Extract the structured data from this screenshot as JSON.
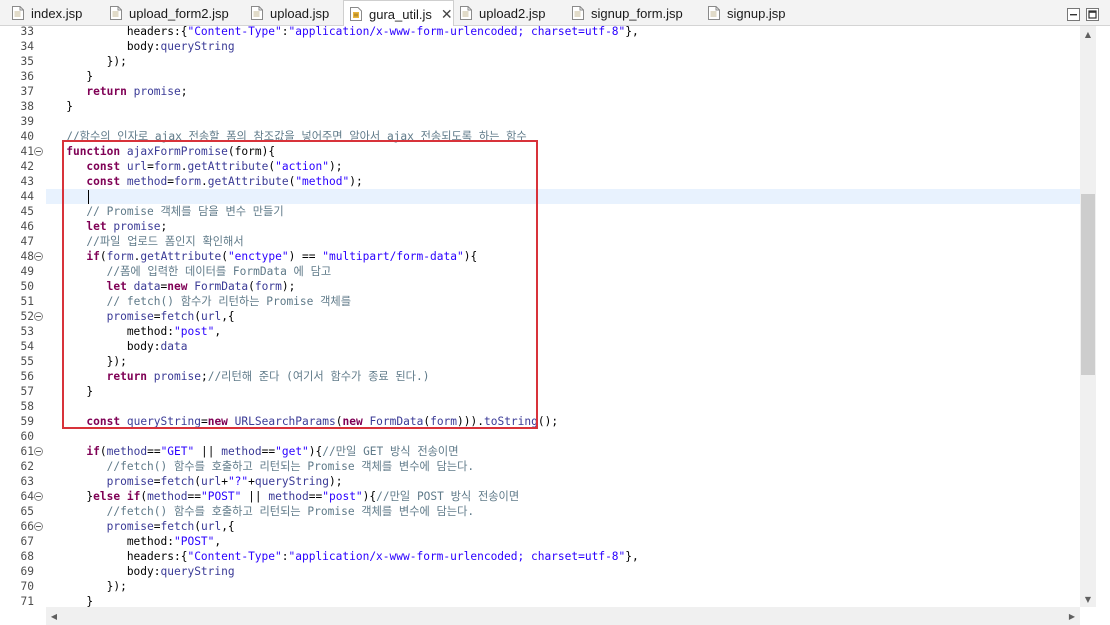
{
  "tabs": [
    {
      "label": "index.jsp",
      "active": false
    },
    {
      "label": "upload_form2.jsp",
      "active": false
    },
    {
      "label": "upload.jsp",
      "active": false
    },
    {
      "label": "gura_util.js",
      "active": true
    },
    {
      "label": "upload2.jsp",
      "active": false
    },
    {
      "label": "signup_form.jsp",
      "active": false
    },
    {
      "label": "signup.jsp",
      "active": false
    }
  ],
  "close_glyph": "✕",
  "editor": {
    "current_line": 44,
    "lines": [
      {
        "n": 33,
        "fold": false,
        "segs": [
          [
            "pl",
            "            headers:{"
          ],
          [
            "str",
            "\"Content-Type\""
          ],
          [
            "pl",
            ":"
          ],
          [
            "str",
            "\"application/x-www-form-urlencoded; charset=utf-8\""
          ],
          [
            "pl",
            "},"
          ]
        ]
      },
      {
        "n": 34,
        "fold": false,
        "segs": [
          [
            "pl",
            "            body:"
          ],
          [
            "id",
            "queryString"
          ]
        ]
      },
      {
        "n": 35,
        "fold": false,
        "segs": [
          [
            "pl",
            "         });"
          ]
        ]
      },
      {
        "n": 36,
        "fold": false,
        "segs": [
          [
            "pl",
            "      }"
          ]
        ]
      },
      {
        "n": 37,
        "fold": false,
        "segs": [
          [
            "pl",
            "      "
          ],
          [
            "kw",
            "return"
          ],
          [
            "pl",
            " "
          ],
          [
            "id",
            "promise"
          ],
          [
            "pl",
            ";"
          ]
        ]
      },
      {
        "n": 38,
        "fold": false,
        "segs": [
          [
            "pl",
            "   }"
          ]
        ]
      },
      {
        "n": 39,
        "fold": false,
        "segs": []
      },
      {
        "n": 40,
        "fold": false,
        "segs": [
          [
            "cm",
            "   //함수의 인자로 ajax 전송할 폼의 참조값을 넣어주면 알아서 ajax 전송되도록 하는 함수"
          ]
        ]
      },
      {
        "n": 41,
        "fold": true,
        "segs": [
          [
            "pl",
            "   "
          ],
          [
            "kw",
            "function"
          ],
          [
            "pl",
            " "
          ],
          [
            "id",
            "ajaxFormPromise"
          ],
          [
            "pl",
            "(form){"
          ]
        ]
      },
      {
        "n": 42,
        "fold": false,
        "segs": [
          [
            "pl",
            "      "
          ],
          [
            "kw",
            "const"
          ],
          [
            "pl",
            " "
          ],
          [
            "id",
            "url"
          ],
          [
            "pl",
            "="
          ],
          [
            "id",
            "form"
          ],
          [
            "pl",
            "."
          ],
          [
            "id",
            "getAttribute"
          ],
          [
            "pl",
            "("
          ],
          [
            "str",
            "\"action\""
          ],
          [
            "pl",
            ");"
          ]
        ]
      },
      {
        "n": 43,
        "fold": false,
        "segs": [
          [
            "pl",
            "      "
          ],
          [
            "kw",
            "const"
          ],
          [
            "pl",
            " "
          ],
          [
            "id",
            "method"
          ],
          [
            "pl",
            "="
          ],
          [
            "id",
            "form"
          ],
          [
            "pl",
            "."
          ],
          [
            "id",
            "getAttribute"
          ],
          [
            "pl",
            "("
          ],
          [
            "str",
            "\"method\""
          ],
          [
            "pl",
            ");"
          ]
        ]
      },
      {
        "n": 44,
        "fold": false,
        "segs": [
          [
            "pl",
            "      "
          ]
        ]
      },
      {
        "n": 45,
        "fold": false,
        "segs": [
          [
            "pl",
            "      "
          ],
          [
            "cm",
            "// Promise 객체를 담을 변수 만들기"
          ]
        ]
      },
      {
        "n": 46,
        "fold": false,
        "segs": [
          [
            "pl",
            "      "
          ],
          [
            "kw",
            "let"
          ],
          [
            "pl",
            " "
          ],
          [
            "id",
            "promise"
          ],
          [
            "pl",
            ";"
          ]
        ]
      },
      {
        "n": 47,
        "fold": false,
        "segs": [
          [
            "pl",
            "      "
          ],
          [
            "cm",
            "//파일 업로드 폼인지 확인해서"
          ]
        ]
      },
      {
        "n": 48,
        "fold": true,
        "segs": [
          [
            "pl",
            "      "
          ],
          [
            "kw",
            "if"
          ],
          [
            "pl",
            "("
          ],
          [
            "id",
            "form"
          ],
          [
            "pl",
            "."
          ],
          [
            "id",
            "getAttribute"
          ],
          [
            "pl",
            "("
          ],
          [
            "str",
            "\"enctype\""
          ],
          [
            "pl",
            ") == "
          ],
          [
            "str",
            "\"multipart/form-data\""
          ],
          [
            "pl",
            "){"
          ]
        ]
      },
      {
        "n": 49,
        "fold": false,
        "segs": [
          [
            "pl",
            "         "
          ],
          [
            "cm",
            "//폼에 입력한 데이터를 FormData 에 담고"
          ]
        ]
      },
      {
        "n": 50,
        "fold": false,
        "segs": [
          [
            "pl",
            "         "
          ],
          [
            "kw",
            "let"
          ],
          [
            "pl",
            " "
          ],
          [
            "id",
            "data"
          ],
          [
            "pl",
            "="
          ],
          [
            "kw",
            "new"
          ],
          [
            "pl",
            " "
          ],
          [
            "id",
            "FormData"
          ],
          [
            "pl",
            "("
          ],
          [
            "id",
            "form"
          ],
          [
            "pl",
            ");"
          ]
        ]
      },
      {
        "n": 51,
        "fold": false,
        "segs": [
          [
            "pl",
            "         "
          ],
          [
            "cm",
            "// fetch() 함수가 리턴하는 Promise 객체를"
          ]
        ]
      },
      {
        "n": 52,
        "fold": true,
        "segs": [
          [
            "pl",
            "         "
          ],
          [
            "id",
            "promise"
          ],
          [
            "pl",
            "="
          ],
          [
            "id",
            "fetch"
          ],
          [
            "pl",
            "("
          ],
          [
            "id",
            "url"
          ],
          [
            "pl",
            ",{"
          ]
        ]
      },
      {
        "n": 53,
        "fold": false,
        "segs": [
          [
            "pl",
            "            method:"
          ],
          [
            "str",
            "\"post\""
          ],
          [
            "pl",
            ","
          ]
        ]
      },
      {
        "n": 54,
        "fold": false,
        "segs": [
          [
            "pl",
            "            body:"
          ],
          [
            "id",
            "data"
          ]
        ]
      },
      {
        "n": 55,
        "fold": false,
        "segs": [
          [
            "pl",
            "         });"
          ]
        ]
      },
      {
        "n": 56,
        "fold": false,
        "segs": [
          [
            "pl",
            "         "
          ],
          [
            "kw",
            "return"
          ],
          [
            "pl",
            " "
          ],
          [
            "id",
            "promise"
          ],
          [
            "pl",
            ";"
          ],
          [
            "cm",
            "//리턴해 준다 (여기서 함수가 종료 된다.)"
          ]
        ]
      },
      {
        "n": 57,
        "fold": false,
        "segs": [
          [
            "pl",
            "      }"
          ]
        ]
      },
      {
        "n": 58,
        "fold": false,
        "segs": []
      },
      {
        "n": 59,
        "fold": false,
        "segs": [
          [
            "pl",
            "      "
          ],
          [
            "kw",
            "const"
          ],
          [
            "pl",
            " "
          ],
          [
            "id",
            "queryString"
          ],
          [
            "pl",
            "="
          ],
          [
            "kw",
            "new"
          ],
          [
            "pl",
            " "
          ],
          [
            "id",
            "URLSearchParams"
          ],
          [
            "pl",
            "("
          ],
          [
            "kw",
            "new"
          ],
          [
            "pl",
            " "
          ],
          [
            "id",
            "FormData"
          ],
          [
            "pl",
            "("
          ],
          [
            "id",
            "form"
          ],
          [
            "pl",
            ")))."
          ],
          [
            "id",
            "toString"
          ],
          [
            "pl",
            "();"
          ]
        ]
      },
      {
        "n": 60,
        "fold": false,
        "segs": []
      },
      {
        "n": 61,
        "fold": true,
        "segs": [
          [
            "pl",
            "      "
          ],
          [
            "kw",
            "if"
          ],
          [
            "pl",
            "("
          ],
          [
            "id",
            "method"
          ],
          [
            "pl",
            "=="
          ],
          [
            "str",
            "\"GET\""
          ],
          [
            "pl",
            " || "
          ],
          [
            "id",
            "method"
          ],
          [
            "pl",
            "=="
          ],
          [
            "str",
            "\"get\""
          ],
          [
            "pl",
            "){"
          ],
          [
            "cm",
            "//만일 GET 방식 전송이면"
          ]
        ]
      },
      {
        "n": 62,
        "fold": false,
        "segs": [
          [
            "pl",
            "         "
          ],
          [
            "cm",
            "//fetch() 함수를 호출하고 리턴되는 Promise 객체를 변수에 담는다."
          ]
        ]
      },
      {
        "n": 63,
        "fold": false,
        "segs": [
          [
            "pl",
            "         "
          ],
          [
            "id",
            "promise"
          ],
          [
            "pl",
            "="
          ],
          [
            "id",
            "fetch"
          ],
          [
            "pl",
            "("
          ],
          [
            "id",
            "url"
          ],
          [
            "pl",
            "+"
          ],
          [
            "str",
            "\"?\""
          ],
          [
            "pl",
            "+"
          ],
          [
            "id",
            "queryString"
          ],
          [
            "pl",
            ");"
          ]
        ]
      },
      {
        "n": 64,
        "fold": true,
        "segs": [
          [
            "pl",
            "      }"
          ],
          [
            "kw",
            "else if"
          ],
          [
            "pl",
            "("
          ],
          [
            "id",
            "method"
          ],
          [
            "pl",
            "=="
          ],
          [
            "str",
            "\"POST\""
          ],
          [
            "pl",
            " || "
          ],
          [
            "id",
            "method"
          ],
          [
            "pl",
            "=="
          ],
          [
            "str",
            "\"post\""
          ],
          [
            "pl",
            "){"
          ],
          [
            "cm",
            "//만일 POST 방식 전송이면"
          ]
        ]
      },
      {
        "n": 65,
        "fold": false,
        "segs": [
          [
            "pl",
            "         "
          ],
          [
            "cm",
            "//fetch() 함수를 호출하고 리턴되는 Promise 객체를 변수에 담는다."
          ]
        ]
      },
      {
        "n": 66,
        "fold": true,
        "segs": [
          [
            "pl",
            "         "
          ],
          [
            "id",
            "promise"
          ],
          [
            "pl",
            "="
          ],
          [
            "id",
            "fetch"
          ],
          [
            "pl",
            "("
          ],
          [
            "id",
            "url"
          ],
          [
            "pl",
            ",{"
          ]
        ]
      },
      {
        "n": 67,
        "fold": false,
        "segs": [
          [
            "pl",
            "            method:"
          ],
          [
            "str",
            "\"POST\""
          ],
          [
            "pl",
            ","
          ]
        ]
      },
      {
        "n": 68,
        "fold": false,
        "segs": [
          [
            "pl",
            "            headers:{"
          ],
          [
            "str",
            "\"Content-Type\""
          ],
          [
            "pl",
            ":"
          ],
          [
            "str",
            "\"application/x-www-form-urlencoded; charset=utf-8\""
          ],
          [
            "pl",
            "},"
          ]
        ]
      },
      {
        "n": 69,
        "fold": false,
        "segs": [
          [
            "pl",
            "            body:"
          ],
          [
            "id",
            "queryString"
          ]
        ]
      },
      {
        "n": 70,
        "fold": false,
        "segs": [
          [
            "pl",
            "         });"
          ]
        ]
      },
      {
        "n": 71,
        "fold": false,
        "segs": [
          [
            "pl",
            "      }"
          ]
        ]
      }
    ]
  },
  "colors": {
    "keyword": "#7f0055",
    "identifier": "#3a3a96",
    "string": "#2a00ff",
    "comment": "#5f7a89",
    "highlight_box": "#d8323a",
    "current_line": "#e8f2fe"
  }
}
